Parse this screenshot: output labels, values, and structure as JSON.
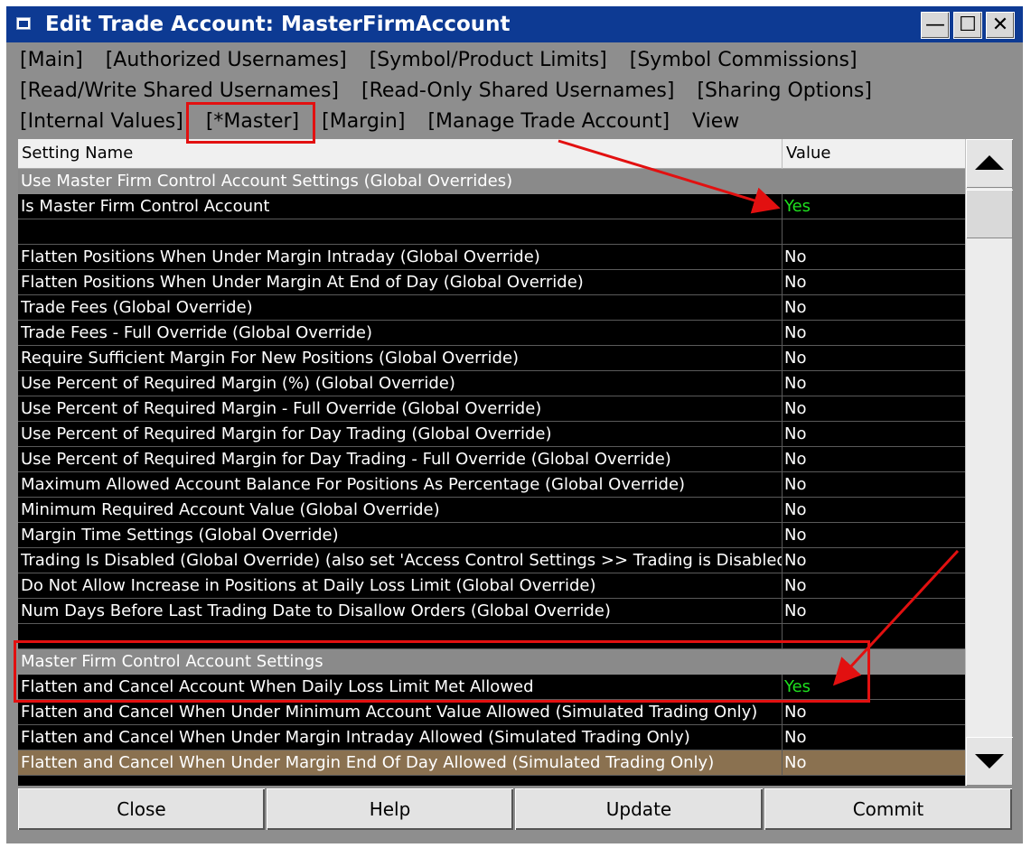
{
  "window": {
    "title": "Edit Trade Account: MasterFirmAccount",
    "minimize_label": "—",
    "maximize_label": "☐",
    "close_label": "✕"
  },
  "menu": {
    "row1": [
      "[Main]",
      "[Authorized Usernames]",
      "[Symbol/Product Limits]",
      "[Symbol Commissions]"
    ],
    "row2": [
      "[Read/Write Shared Usernames]",
      "[Read-Only Shared Usernames]",
      "[Sharing Options]"
    ],
    "row3": [
      "[Internal Values]",
      "[*Master]",
      "[Margin]",
      "[Manage Trade Account]",
      "View"
    ]
  },
  "grid": {
    "headers": {
      "name": "Setting Name",
      "value": "Value"
    },
    "rows": [
      {
        "name": "Use Master Firm Control Account Settings (Global Overrides)",
        "value": ""
      },
      {
        "name": "Is Master Firm Control Account",
        "value": "Yes"
      },
      {
        "name": "",
        "value": ""
      },
      {
        "name": "Flatten Positions When Under Margin Intraday (Global Override)",
        "value": "No"
      },
      {
        "name": "Flatten Positions When Under Margin At End of Day (Global Override)",
        "value": "No"
      },
      {
        "name": "Trade Fees (Global Override)",
        "value": "No"
      },
      {
        "name": "Trade Fees - Full Override (Global Override)",
        "value": "No"
      },
      {
        "name": "Require Sufficient Margin For New Positions (Global Override)",
        "value": "No"
      },
      {
        "name": "Use Percent of Required Margin (%) (Global Override)",
        "value": "No"
      },
      {
        "name": "Use Percent of Required Margin - Full Override (Global Override)",
        "value": "No"
      },
      {
        "name": "Use Percent of Required Margin for Day Trading (Global Override)",
        "value": "No"
      },
      {
        "name": "Use Percent of Required Margin for Day Trading - Full Override (Global Override)",
        "value": "No"
      },
      {
        "name": "Maximum Allowed Account Balance For Positions As Percentage (Global Override)",
        "value": "No"
      },
      {
        "name": "Minimum Required Account Value (Global Override)",
        "value": "No"
      },
      {
        "name": "Margin Time Settings (Global Override)",
        "value": "No"
      },
      {
        "name": "Trading Is Disabled (Global Override) (also set 'Access Control Settings >> Trading is Disabled",
        "value": "No"
      },
      {
        "name": "Do Not Allow Increase in Positions at Daily Loss Limit (Global Override)",
        "value": "No"
      },
      {
        "name": "Num Days Before Last Trading Date to Disallow Orders (Global Override)",
        "value": "No"
      },
      {
        "name": "",
        "value": ""
      },
      {
        "name": "Master Firm Control Account Settings",
        "value": ""
      },
      {
        "name": "Flatten and Cancel Account When Daily Loss Limit Met Allowed",
        "value": "Yes"
      },
      {
        "name": "Flatten and Cancel When Under Minimum Account Value Allowed (Simulated Trading Only)",
        "value": "No"
      },
      {
        "name": "Flatten and Cancel When Under Margin Intraday Allowed (Simulated Trading Only)",
        "value": "No"
      },
      {
        "name": "Flatten and Cancel When Under Margin End Of Day Allowed (Simulated Trading Only)",
        "value": "No"
      }
    ]
  },
  "buttons": {
    "close": "Close",
    "help": "Help",
    "update": "Update",
    "commit": "Commit"
  },
  "colors": {
    "titlebar": "#0d3a93",
    "grid_bg": "#000000",
    "section_bg": "#8a8a8a",
    "selected_bg": "#8a7150",
    "yes_text": "#1ee01e",
    "annotation_red": "#e21010"
  },
  "icons": [
    "app-icon",
    "minimize-icon",
    "maximize-icon",
    "close-icon",
    "scroll-up-icon",
    "scroll-down-icon"
  ]
}
